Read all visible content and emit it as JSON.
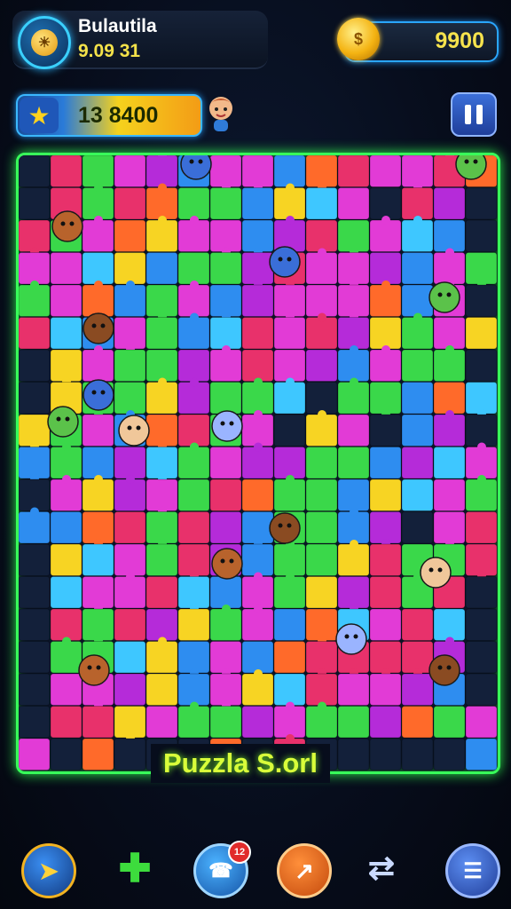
{
  "profile": {
    "name": "Bulautila",
    "subtitle": "9.09 31",
    "avatar_icon": "sun-emblem-icon"
  },
  "coins": {
    "value": "9900",
    "icon": "gold-coin-icon"
  },
  "score": {
    "value": "13 8400",
    "icon": "star-icon"
  },
  "board": {
    "title": "Puzzla S.orl",
    "border_color": "#38ff5a",
    "palette": [
      "#e23bd6",
      "#3ad84a",
      "#2e8df0",
      "#f7d423",
      "#ff6a2a",
      "#b52bd9",
      "#3ec7ff",
      "#e8316b"
    ]
  },
  "nav": [
    {
      "icon": "compass-icon"
    },
    {
      "icon": "puzzle-piece-icon"
    },
    {
      "icon": "phone-icon",
      "badge": "12"
    },
    {
      "icon": "arrow-icon"
    },
    {
      "icon": "shuffle-icon"
    },
    {
      "icon": "menu-icon"
    }
  ]
}
